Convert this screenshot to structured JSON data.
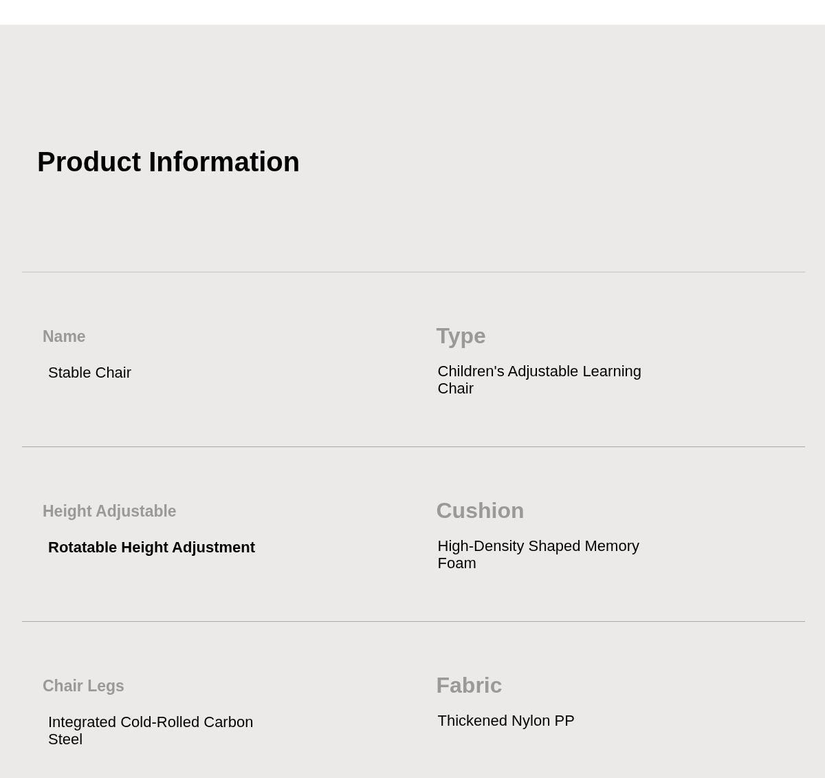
{
  "title": "Product Information",
  "rows": [
    {
      "cells": [
        {
          "label": "Name",
          "value": "Stable Chair",
          "bold": false
        },
        {
          "label": "Type",
          "value": "Children's Adjustable Learning Chair",
          "bold": false
        }
      ]
    },
    {
      "cells": [
        {
          "label": "Height Adjustable",
          "value": "Rotatable Height Adjustment",
          "bold": true
        },
        {
          "label": "Cushion",
          "value": "High-Density Shaped Memory Foam",
          "bold": false
        }
      ]
    },
    {
      "cells": [
        {
          "label": "Chair Legs",
          "value": "Integrated Cold-Rolled Carbon Steel",
          "bold": false
        },
        {
          "label": "Fabric",
          "value": "Thickened Nylon PP",
          "bold": false
        }
      ]
    }
  ]
}
